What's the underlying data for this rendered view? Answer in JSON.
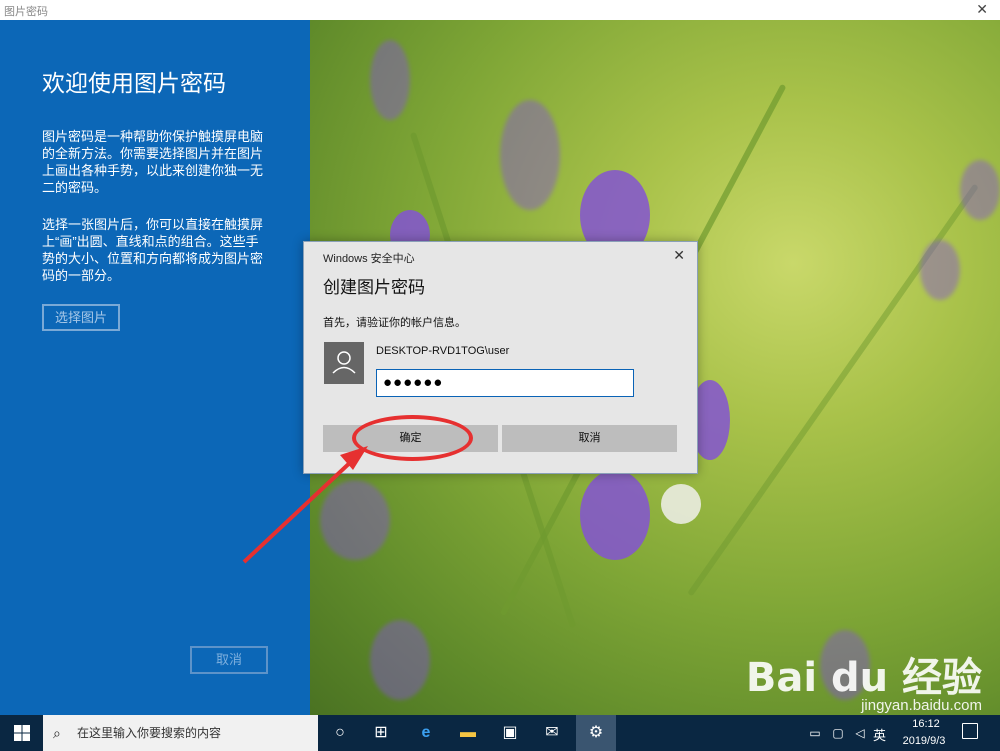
{
  "window": {
    "title": "图片密码",
    "close_glyph": "✕"
  },
  "left_panel": {
    "heading": "欢迎使用图片密码",
    "paragraph1": "图片密码是一种帮助你保护触摸屏电脑的全新方法。你需要选择图片并在图片上画出各种手势，以此来创建你独一无二的密码。",
    "paragraph2": "选择一张图片后，你可以直接在触摸屏上“画”出圆、直线和点的组合。这些手势的大小、位置和方向都将成为图片密码的一部分。",
    "choose_picture_button": "选择图片",
    "cancel_button": "取消"
  },
  "dialog": {
    "title": "Windows 安全中心",
    "close_glyph": "✕",
    "heading": "创建图片密码",
    "prompt": "首先，请验证你的帐户信息。",
    "username": "DESKTOP-RVD1TOG\\user",
    "password_masked": "●●●●●●",
    "ok_button": "确定",
    "cancel_button": "取消"
  },
  "watermark": {
    "brand": "Bai du 经验",
    "site": "jingyan.baidu.com"
  },
  "taskbar": {
    "search_placeholder": "在这里输入你要搜索的内容",
    "icons": [
      "windows-start-icon",
      "search-icon",
      "cortana-icon",
      "task-view-icon",
      "edge-icon",
      "file-explorer-icon",
      "store-icon",
      "mail-icon",
      "settings-icon"
    ],
    "ime": "英",
    "time": "16:12",
    "date": "2019/9/3"
  },
  "colors": {
    "left_panel": "#0c67b7",
    "taskbar": "#0a2742",
    "annotation": "#e63030",
    "dialog_bg": "#e6e6e6"
  }
}
